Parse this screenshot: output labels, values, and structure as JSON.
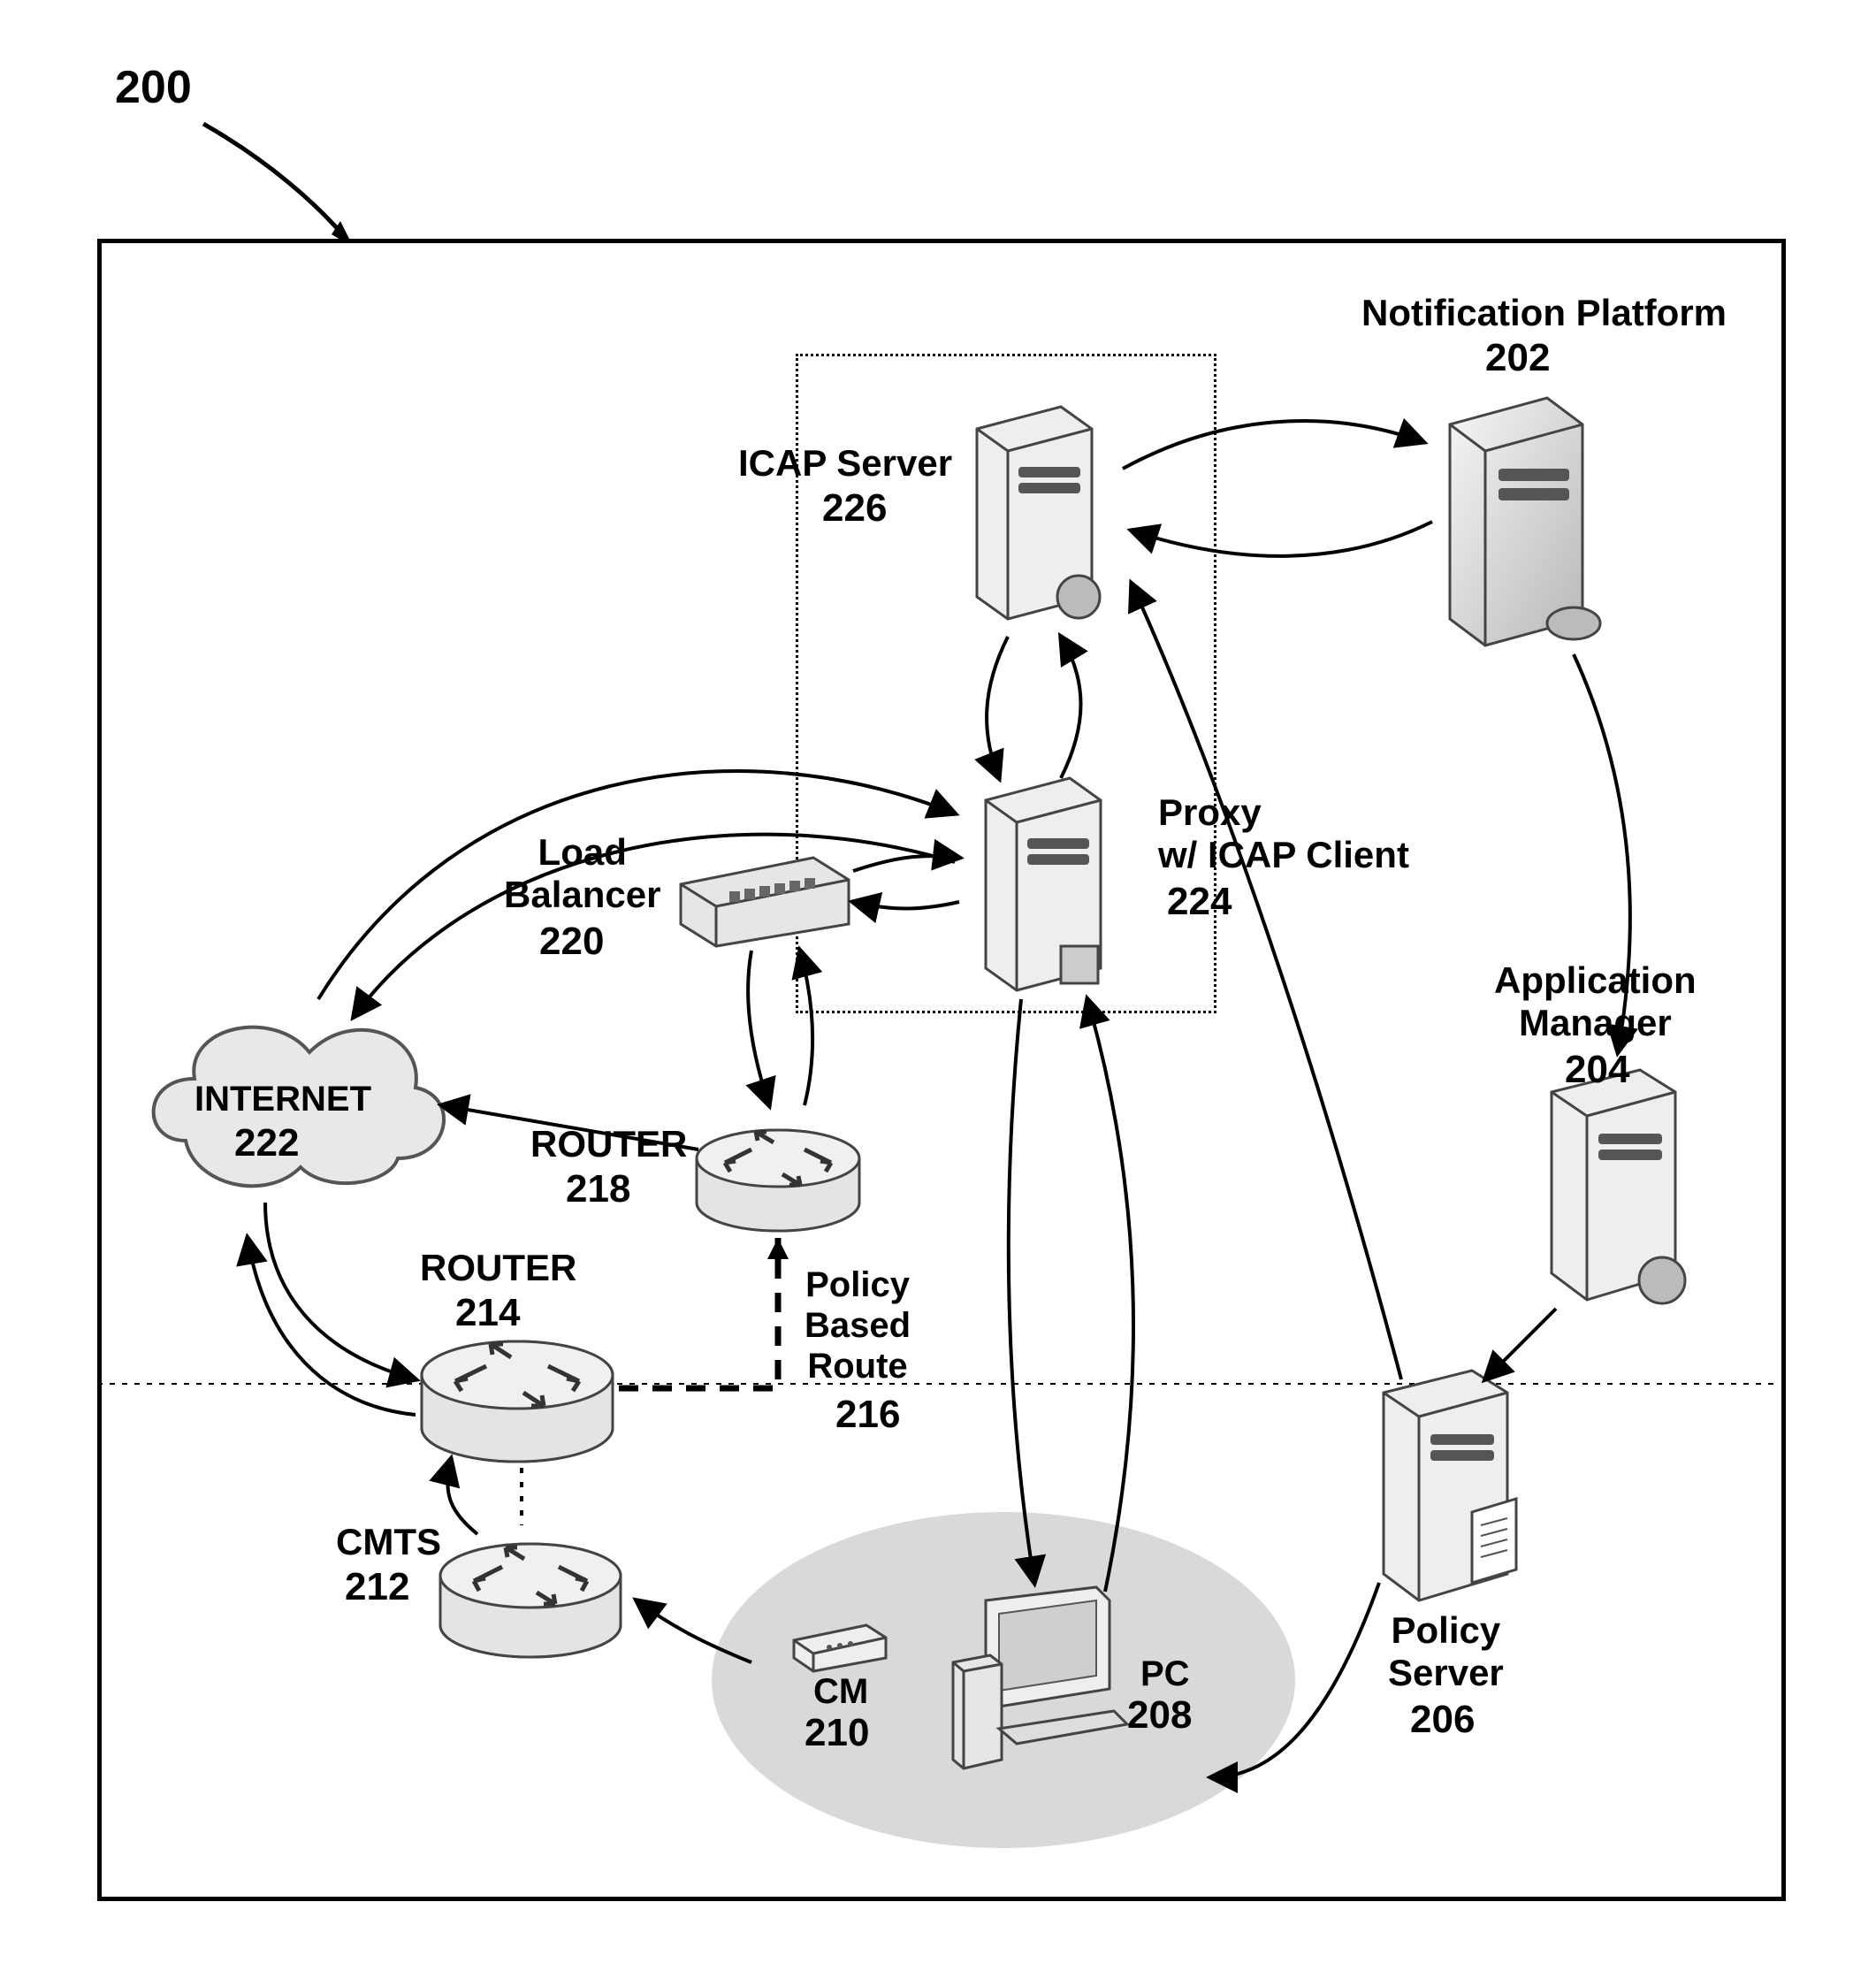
{
  "figure_number": "200",
  "nodes": {
    "notification_platform": {
      "title": "Notification Platform",
      "num": "202"
    },
    "icap_server": {
      "title": "ICAP Server",
      "num": "226"
    },
    "proxy": {
      "title": "Proxy\nw/ ICAP Client",
      "num": "224"
    },
    "load_balancer": {
      "title": "Load\nBalancer",
      "num": "220"
    },
    "application_manager": {
      "title": "Application\nManager",
      "num": "204"
    },
    "internet": {
      "title": "INTERNET",
      "num": "222"
    },
    "router_218": {
      "title": "ROUTER",
      "num": "218"
    },
    "router_214": {
      "title": "ROUTER",
      "num": "214"
    },
    "policy_route": {
      "title": "Policy\nBased\nRoute",
      "num": "216"
    },
    "cmts": {
      "title": "CMTS",
      "num": "212"
    },
    "policy_server": {
      "title": "Policy\nServer",
      "num": "206"
    },
    "cm": {
      "title": "CM",
      "num": "210"
    },
    "pc": {
      "title": "PC",
      "num": "208"
    }
  }
}
